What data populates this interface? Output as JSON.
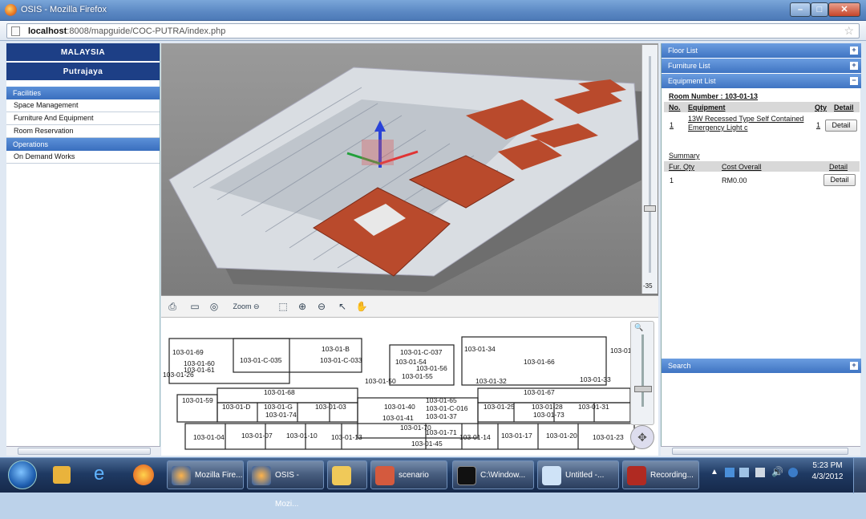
{
  "window": {
    "title": "OSIS - Mozilla Firefox"
  },
  "address_bar": {
    "host": "localhost",
    "path": ":8008/mapguide/COC-PUTRA/index.php"
  },
  "left_panel": {
    "country": "MALAYSIA",
    "city": "Putrajaya",
    "sections": [
      {
        "title": "Facilities",
        "items": [
          "Space Management",
          "Furniture And Equipment",
          "Room Reservation"
        ]
      },
      {
        "title": "Operations",
        "items": [
          "On Demand Works"
        ]
      }
    ]
  },
  "viewer": {
    "scale_label": "-35"
  },
  "toolbar": {
    "zoom_label": "Zoom"
  },
  "floor_plan": {
    "room_labels": [
      "103-01-69",
      "103-01-C-035",
      "103-01-C-033",
      "103-01-B",
      "103-01-C-037",
      "103-01-54",
      "103-01-56",
      "103-01-55",
      "103-01-34",
      "103-01-66",
      "103-01-72",
      "103-01-60",
      "103-01-61",
      "103-01-26",
      "103-01-50",
      "103-01-32",
      "103-01-33",
      "103-01-68",
      "103-01-67",
      "103-01-59",
      "103-01-D",
      "103-01-G",
      "103-01-03",
      "103-01-40",
      "103-01-65",
      "103-01-C-016",
      "103-01-25",
      "103-01-28",
      "103-01-31",
      "103-01-74",
      "103-01-41",
      "103-01-37",
      "103-01-73",
      "103-01-70",
      "103-01-71",
      "103-01-04",
      "103-01-07",
      "103-01-10",
      "103-01-13",
      "103-01-45",
      "103-01-14",
      "103-01-17",
      "103-01-20",
      "103-01-23"
    ]
  },
  "right_panel": {
    "sections": {
      "floor_list": "Floor List",
      "furniture_list": "Furniture List",
      "equipment_list": "Equipment List",
      "search": "Search"
    },
    "room_number": "Room Number : 103-01-13",
    "equipment_headers": {
      "no": "No.",
      "equipment": "Equipment",
      "qty": "Qty",
      "detail": "Detail"
    },
    "equipment_rows": [
      {
        "no": "1",
        "equipment": "13W Recessed Type Self Contained Emergency Light c",
        "qty": "1",
        "detail": "Detail"
      }
    ],
    "summary_title": "Summary",
    "summary_headers": {
      "fur_qty": "Fur. Qty",
      "cost_overall": "Cost Overall",
      "detail": "Detail"
    },
    "summary_rows": [
      {
        "fur_qty": "1",
        "cost_overall": "RM0.00",
        "detail": "Detail"
      }
    ]
  },
  "taskbar": {
    "tasks": [
      "Mozilla Fire...",
      "OSIS - Mozi...",
      "",
      "scenario",
      "C:\\Window...",
      "Untitled -...",
      "Recording..."
    ],
    "time": "5:23 PM",
    "date": "4/3/2012"
  }
}
